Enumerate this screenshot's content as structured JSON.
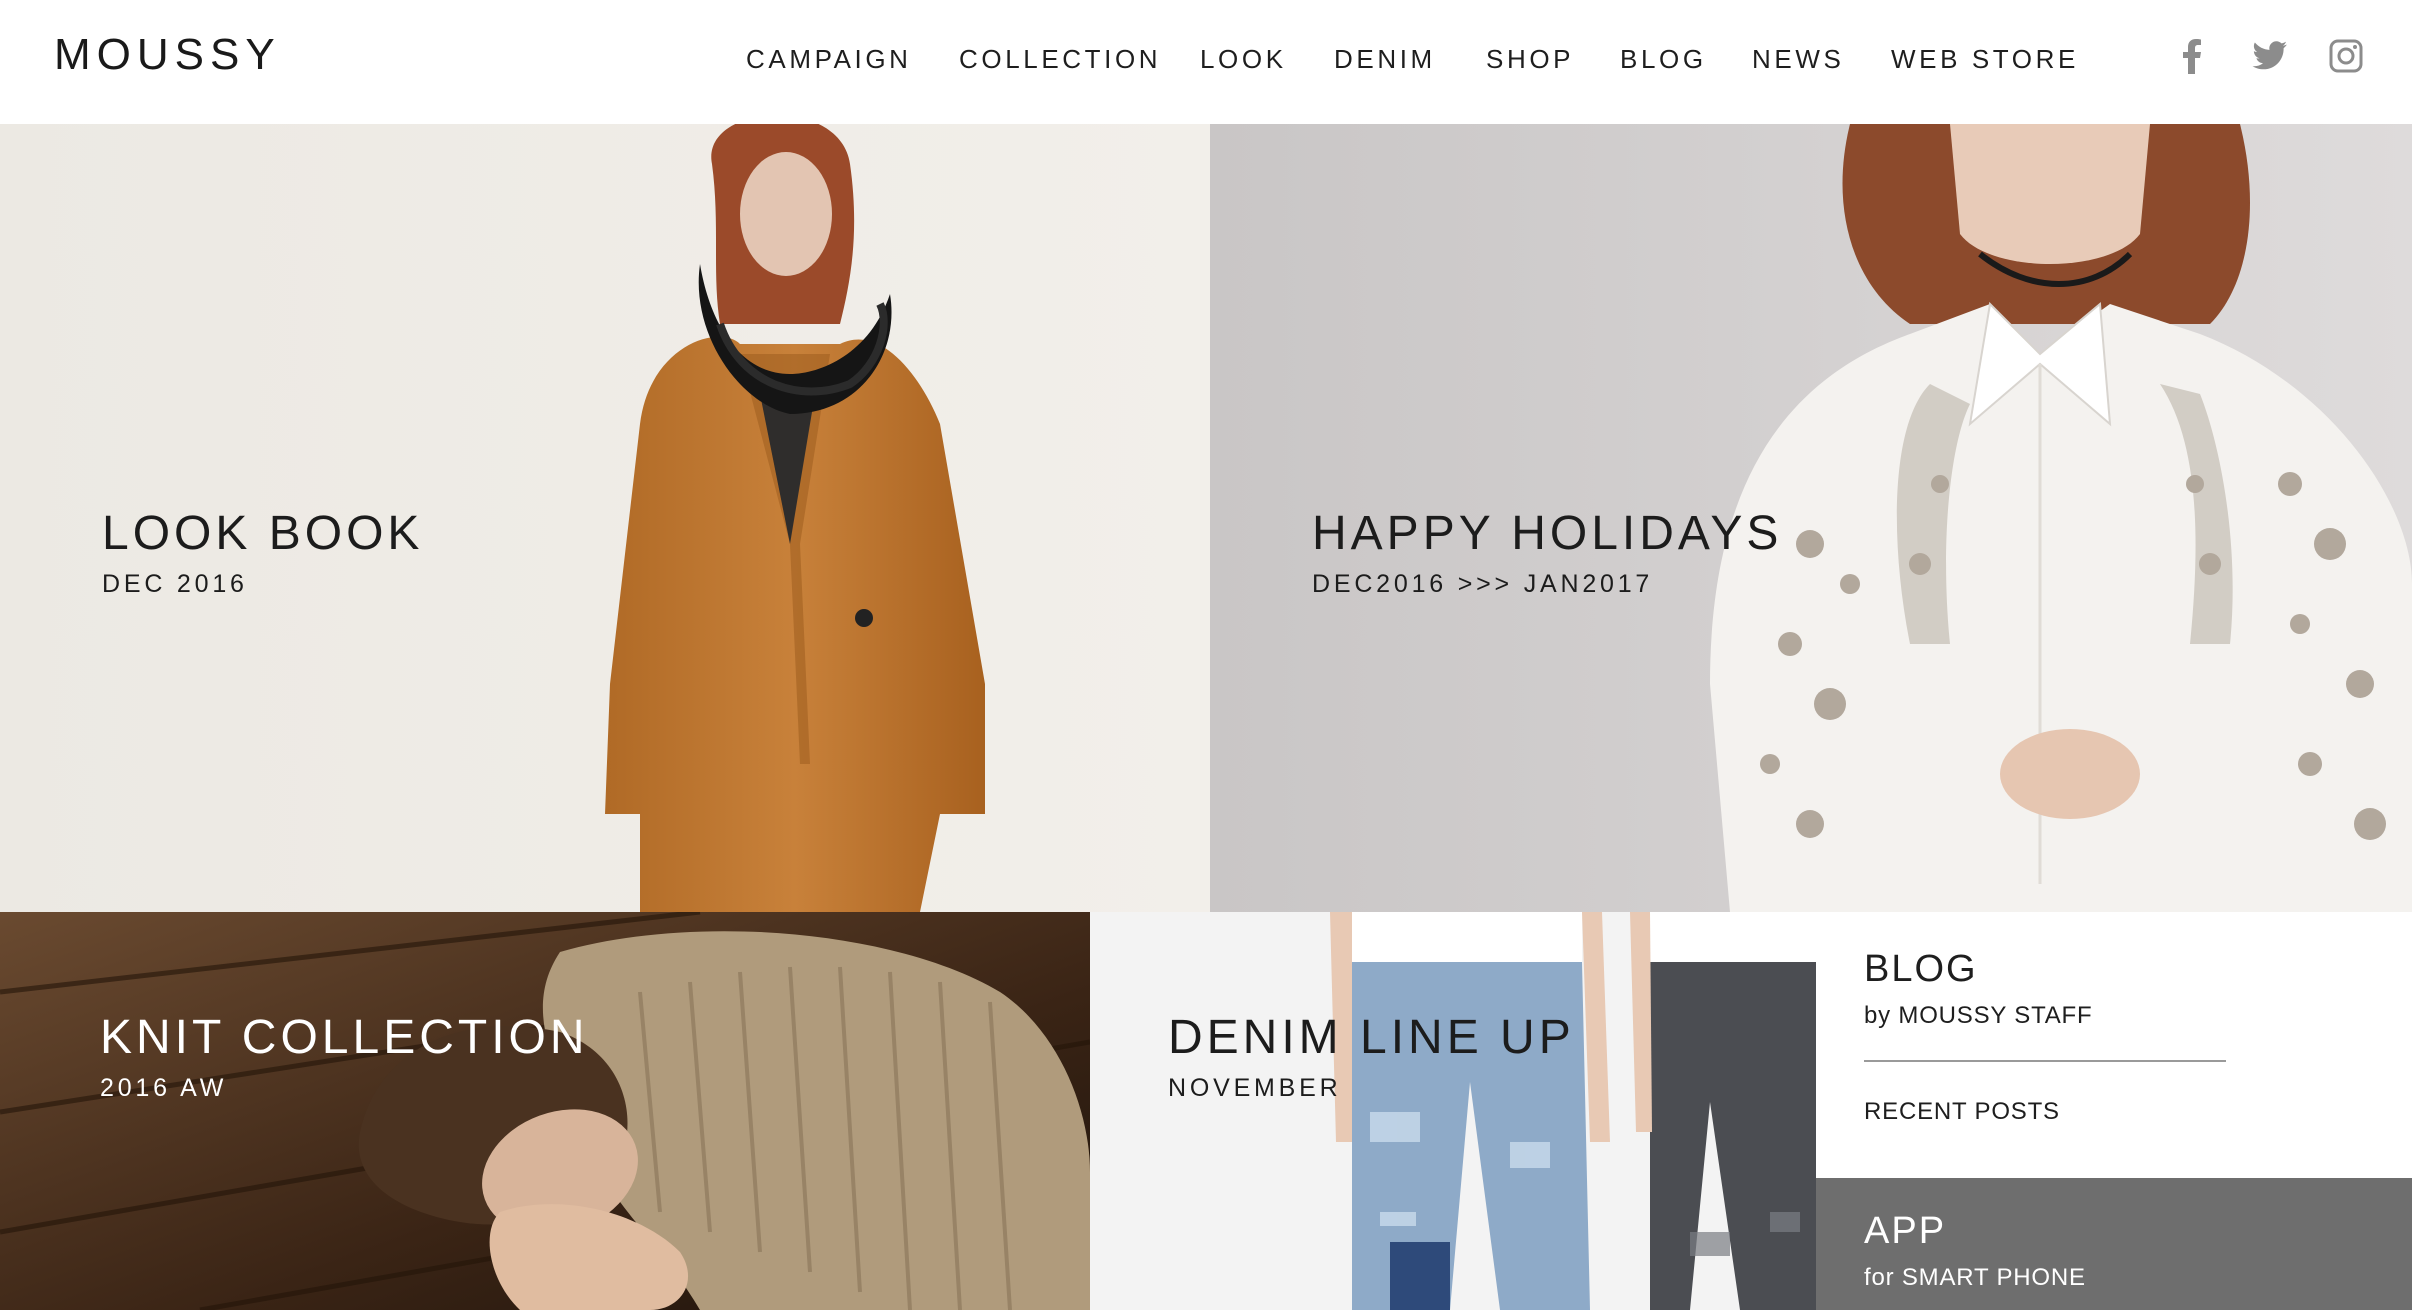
{
  "brand": {
    "logo": "MOUSSY"
  },
  "nav": {
    "items": [
      {
        "label": "CAMPAIGN"
      },
      {
        "label": "COLLECTION"
      },
      {
        "label": "LOOK"
      },
      {
        "label": "DENIM"
      },
      {
        "label": "SHOP"
      },
      {
        "label": "BLOG"
      },
      {
        "label": "NEWS"
      },
      {
        "label": "WEB STORE"
      }
    ]
  },
  "social": [
    {
      "icon": "facebook-icon"
    },
    {
      "icon": "twitter-icon"
    },
    {
      "icon": "instagram-icon"
    }
  ],
  "tiles": {
    "lookbook": {
      "title": "LOOK BOOK",
      "subtitle": "DEC 2016"
    },
    "holidays": {
      "title": "HAPPY HOLIDAYS",
      "subtitle": "DEC2016 >>> JAN2017"
    },
    "knit": {
      "title": "KNIT COLLECTION",
      "subtitle": "2016 AW"
    },
    "denim": {
      "title": "DENIM LINE UP",
      "subtitle": "NOVEMBER"
    }
  },
  "blog_panel": {
    "title": "BLOG",
    "subtitle": "by MOUSSY STAFF",
    "recent": "RECENT POSTS"
  },
  "app_panel": {
    "title": "APP",
    "subtitle": "for SMART PHONE"
  },
  "colors": {
    "text": "#1e1e1e",
    "app_panel_bg": "#6e6e6e",
    "coat": "#c27b34",
    "divider": "#9a9a9a"
  }
}
